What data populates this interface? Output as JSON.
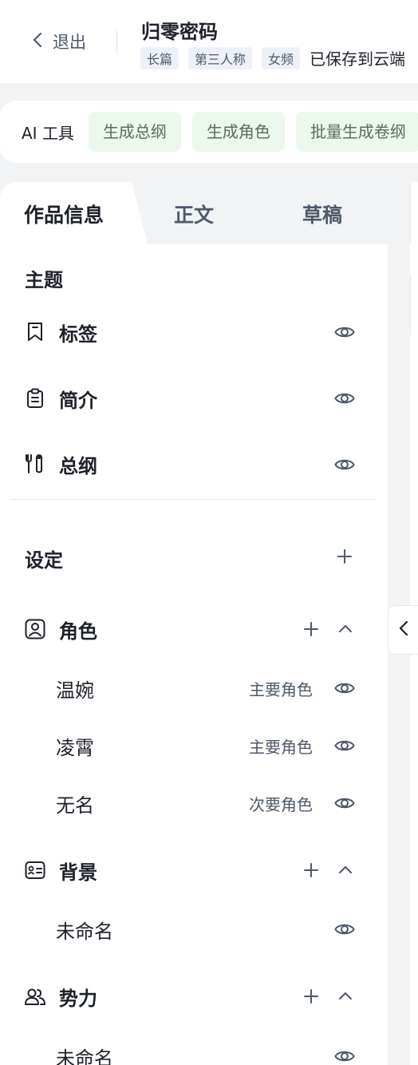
{
  "header": {
    "back_label": "退出",
    "title": "归零密码",
    "tags": [
      "长篇",
      "第三人称",
      "女频"
    ],
    "save_status": "已保存到云端"
  },
  "toolbar": {
    "label": "AI 工具",
    "buttons": [
      "生成总纲",
      "生成角色",
      "批量生成卷纲"
    ]
  },
  "tabs": [
    "作品信息",
    "正文",
    "草稿"
  ],
  "theme": {
    "title": "主题",
    "items": [
      {
        "label": "标签",
        "icon": "bookmark-icon"
      },
      {
        "label": "简介",
        "icon": "clipboard-icon"
      },
      {
        "label": "总纲",
        "icon": "tools-icon"
      }
    ]
  },
  "settings": {
    "title": "设定",
    "character": {
      "label": "角色",
      "items": [
        {
          "name": "温婉",
          "role": "主要角色"
        },
        {
          "name": "凌霄",
          "role": "主要角色"
        },
        {
          "name": "无名",
          "role": "次要角色"
        }
      ]
    },
    "background": {
      "label": "背景",
      "items": [
        {
          "name": "未命名"
        }
      ]
    },
    "faction": {
      "label": "势力",
      "items": [
        {
          "name": "未命名"
        }
      ]
    }
  },
  "colors": {
    "accent_bg": "#ecf7ed",
    "tag_bg": "#edf1f7",
    "text_primary": "#1d2129",
    "text_secondary": "#4e5969"
  }
}
